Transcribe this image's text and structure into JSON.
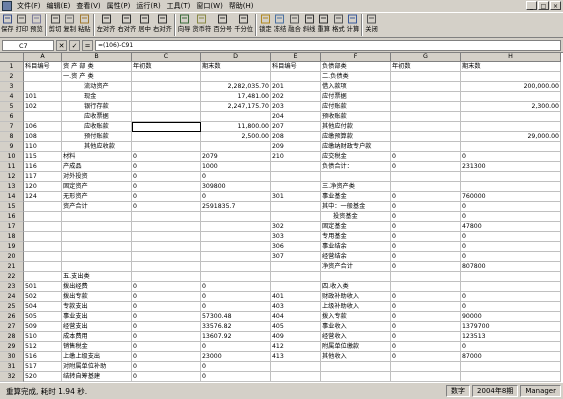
{
  "menu": [
    "文件(F)",
    "编辑(E)",
    "查看(V)",
    "属性(P)",
    "运行(R)",
    "工具(T)",
    "窗口(W)",
    "帮助(H)"
  ],
  "window_buttons": [
    "_",
    "□",
    "×"
  ],
  "toolbar": [
    {
      "label": "保存",
      "icon": "floppy-icon"
    },
    {
      "label": "打印",
      "icon": "printer-icon"
    },
    {
      "label": "预览",
      "icon": "preview-icon"
    },
    {
      "sep": true
    },
    {
      "label": "剪切",
      "icon": "scissors-icon"
    },
    {
      "label": "复制",
      "icon": "copy-icon"
    },
    {
      "label": "粘贴",
      "icon": "paste-icon"
    },
    {
      "sep": true
    },
    {
      "label": "左对齐",
      "icon": "align-left-icon"
    },
    {
      "label": "右对齐",
      "icon": "align-right-icon"
    },
    {
      "label": "居中",
      "icon": "align-center-icon"
    },
    {
      "label": "右对齐",
      "icon": "align-right-icon"
    },
    {
      "sep": true
    },
    {
      "label": "向导",
      "icon": "wizard-icon"
    },
    {
      "label": "货币符",
      "icon": "currency-icon"
    },
    {
      "label": "百分号",
      "icon": "percent-icon"
    },
    {
      "label": "千分位",
      "icon": "thousands-icon"
    },
    {
      "sep": true
    },
    {
      "label": "锁定",
      "icon": "lock-icon"
    },
    {
      "label": "冻结",
      "icon": "freeze-icon"
    },
    {
      "label": "融合",
      "icon": "merge-icon"
    },
    {
      "label": "斜线",
      "icon": "diagonal-icon"
    },
    {
      "label": "重算",
      "icon": "recalc-icon"
    },
    {
      "label": "格式",
      "icon": "format-icon"
    },
    {
      "label": "计算",
      "icon": "calc-icon"
    },
    {
      "sep": true
    },
    {
      "label": "关闭",
      "icon": "close-icon"
    }
  ],
  "formula_bar": {
    "cell_ref": "C7",
    "fx_cancel": "✕",
    "fx_ok": "✓",
    "fx_eq": "=",
    "formula": "=(106)-C91"
  },
  "columns": [
    "",
    "A",
    "B",
    "C",
    "D",
    "E",
    "F",
    "G",
    "H"
  ],
  "rows": [
    [
      "1",
      "科目编号",
      "资 产 部 类",
      "年初数",
      "期末数",
      "科目编号",
      "负债部类",
      "年初数",
      "期末数"
    ],
    [
      "2",
      "",
      "一.资 产 类",
      "",
      "",
      "",
      "二.负债类",
      "",
      ""
    ],
    [
      "3",
      "",
      "流动资产",
      "",
      "2,282,035.70",
      "201",
      "借入款项",
      "",
      "200,000.00"
    ],
    [
      "4",
      "101",
      "现金",
      "",
      "17,481.00",
      "202",
      "应付票据",
      "",
      ""
    ],
    [
      "5",
      "102",
      "银行存款",
      "",
      "2,247,175.70",
      "203",
      "应付账款",
      "",
      "2,300.00"
    ],
    [
      "6",
      "",
      "应收票据",
      "",
      "",
      "204",
      "预收账款",
      "",
      ""
    ],
    [
      "7",
      "106",
      "应收账款",
      "",
      "11,800.00",
      "207",
      "其他应付款",
      "",
      ""
    ],
    [
      "8",
      "108",
      "预付账款",
      "",
      "2,500.00",
      "208",
      "应缴预算款",
      "",
      "29,000.00"
    ],
    [
      "9",
      "110",
      "其他应收款",
      "",
      "",
      "209",
      "应缴纳财政专户款",
      "",
      ""
    ],
    [
      "10",
      "115",
      "材料",
      "0",
      "2079",
      "210",
      "应交税金",
      "0",
      "0"
    ],
    [
      "11",
      "116",
      "产成品",
      "0",
      "1000",
      "",
      "负债合计：",
      "0",
      "231300"
    ],
    [
      "12",
      "117",
      "对外投资",
      "0",
      "0",
      "",
      "",
      "",
      ""
    ],
    [
      "13",
      "120",
      "固定资产",
      "0",
      "309800",
      "",
      "三.净资产类",
      "",
      ""
    ],
    [
      "14",
      "124",
      "无形资产",
      "0",
      "0",
      "301",
      "事业基金",
      "0",
      "760000"
    ],
    [
      "15",
      "",
      "资产合计",
      "0",
      "2591835.7",
      "",
      "其中：一般基金",
      "0",
      "0"
    ],
    [
      "16",
      "",
      "",
      "",
      "",
      "",
      "投资基金",
      "0",
      "0"
    ],
    [
      "17",
      "",
      "",
      "",
      "",
      "302",
      "固定基金",
      "0",
      "47800"
    ],
    [
      "18",
      "",
      "",
      "",
      "",
      "303",
      "专用基金",
      "0",
      "0"
    ],
    [
      "19",
      "",
      "",
      "",
      "",
      "306",
      "事业结余",
      "0",
      "0"
    ],
    [
      "20",
      "",
      "",
      "",
      "",
      "307",
      "经营结余",
      "0",
      "0"
    ],
    [
      "21",
      "",
      "",
      "",
      "",
      "",
      "净资产合计",
      "0",
      "807800"
    ],
    [
      "22",
      "",
      "五.支出类",
      "",
      "",
      "",
      "",
      "",
      ""
    ],
    [
      "23",
      "501",
      "拨出经费",
      "0",
      "0",
      "",
      "四.收入类",
      "",
      ""
    ],
    [
      "24",
      "502",
      "拨出专款",
      "0",
      "0",
      "401",
      "财政补助收入",
      "0",
      "0"
    ],
    [
      "25",
      "504",
      "专款支出",
      "0",
      "0",
      "403",
      "上级补助收入",
      "0",
      "0"
    ],
    [
      "26",
      "505",
      "事业支出",
      "0",
      "57300.48",
      "404",
      "拨入专款",
      "0",
      "90000"
    ],
    [
      "27",
      "509",
      "经营支出",
      "0",
      "33576.82",
      "405",
      "事业收入",
      "0",
      "1379700"
    ],
    [
      "28",
      "510",
      "成本费用",
      "0",
      "13607.92",
      "409",
      "经营收入",
      "0",
      "123513"
    ],
    [
      "29",
      "512",
      "销售税金",
      "0",
      "0",
      "412",
      "附属单位缴款",
      "0",
      "0"
    ],
    [
      "30",
      "516",
      "上缴上级支出",
      "0",
      "23000",
      "413",
      "其他收入",
      "0",
      "87000"
    ],
    [
      "31",
      "517",
      "对附属单位补助",
      "0",
      "0",
      "",
      "",
      "",
      ""
    ],
    [
      "32",
      "520",
      "结转自筹基建",
      "0",
      "0",
      "",
      "",
      "",
      ""
    ]
  ],
  "status": {
    "message": "重算完成, 耗时 1.94 秒.",
    "fields": [
      "数字",
      "2004年8期",
      "Manager"
    ]
  }
}
